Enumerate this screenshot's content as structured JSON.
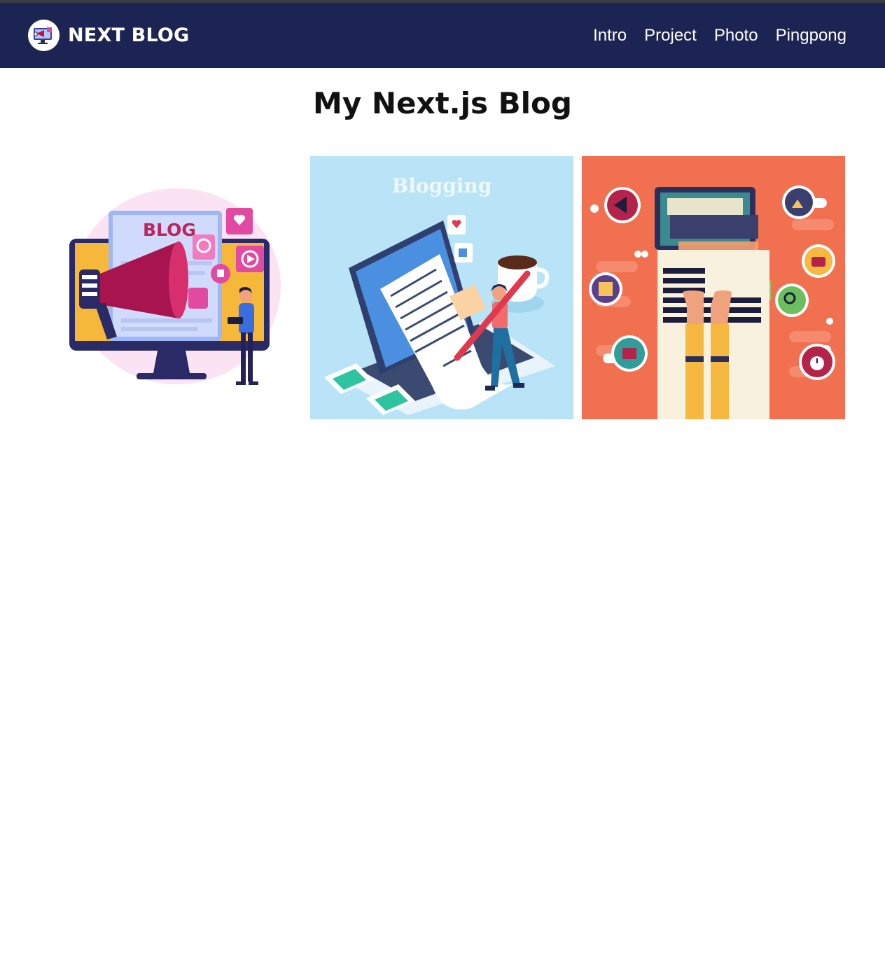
{
  "navbar": {
    "brand_name": "NEXT BLOG",
    "logo_icon": "megaphone-icon",
    "background": "#1b2452",
    "links": [
      {
        "label": "Intro"
      },
      {
        "label": "Project"
      },
      {
        "label": "Photo"
      },
      {
        "label": "Pingpong"
      }
    ]
  },
  "main": {
    "title": "My Next.js Blog",
    "images": [
      {
        "name": "blog-megaphone-illustration",
        "label": "BLOG",
        "background": "#ffffff"
      },
      {
        "name": "blogging-laptop-illustration",
        "label": "Blogging",
        "background": "#b9e4f7"
      },
      {
        "name": "laptop-icons-illustration",
        "background": "#f0704f"
      }
    ]
  }
}
